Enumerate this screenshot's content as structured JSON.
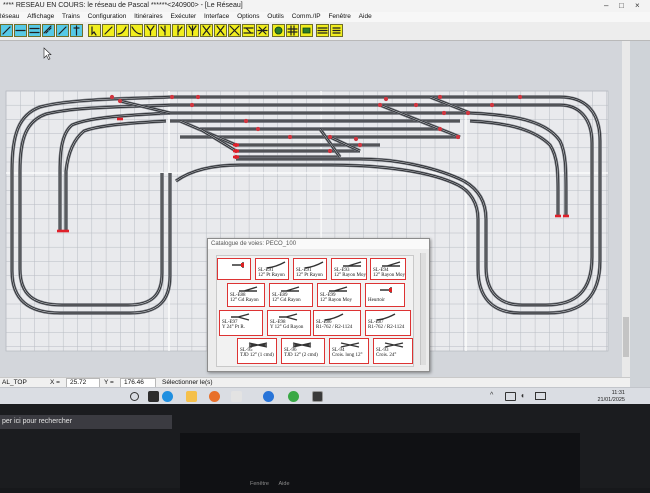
{
  "titlebar": {
    "text": "**** RESEAU EN COURS: le réseau de Pascal ******<240900> - [Le Réseau]"
  },
  "menubar": {
    "items": [
      "Réseau",
      "Affichage",
      "Trains",
      "Configuration",
      "Itinéraires",
      "Exécuter",
      "Interface",
      "Options",
      "Outils",
      "Comm./IP",
      "Fenêtre",
      "Aide"
    ]
  },
  "toolbar": {
    "buttons": [
      {
        "icon": "track-tool-icon",
        "active": true
      },
      {
        "icon": "straight-track-icon",
        "active": true
      },
      {
        "icon": "double-track-icon",
        "active": true
      },
      {
        "icon": "ruler-icon",
        "active": true
      },
      {
        "icon": "brush-icon",
        "active": true
      },
      {
        "icon": "signal-icon",
        "active": true
      },
      {
        "icon": "pointer-icon"
      },
      {
        "icon": "diagonal-track-icon"
      },
      {
        "icon": "curve-track-icon"
      },
      {
        "icon": "curve-track-2-icon"
      },
      {
        "icon": "turnout-y-icon"
      },
      {
        "icon": "turnout-left-icon"
      },
      {
        "icon": "turnout-right-icon"
      },
      {
        "icon": "three-way-turnout-icon"
      },
      {
        "icon": "double-slip-icon"
      },
      {
        "icon": "crossing-icon"
      },
      {
        "icon": "crossing-x-icon"
      },
      {
        "icon": "crossover-icon"
      },
      {
        "icon": "diamond-crossing-icon"
      },
      {
        "icon": "gear-icon"
      },
      {
        "icon": "grid-toggle-icon"
      },
      {
        "icon": "group-icon"
      },
      {
        "icon": "layers-icon"
      },
      {
        "icon": "list-icon"
      }
    ]
  },
  "catalogue": {
    "title": "Catalogue de voies: PECO_100",
    "tiles": [
      {
        "ref": "",
        "label": "",
        "shape": "buffer"
      },
      {
        "ref": "SL-E91",
        "label": "12° Pt Rayon",
        "shape": "curve"
      },
      {
        "ref": "SL-E91",
        "label": "12° Pt Rayon",
        "shape": "curve"
      },
      {
        "ref": "SL-E93",
        "label": "12° Rayon Moy",
        "shape": "turnout"
      },
      {
        "ref": "SL-E94",
        "label": "12° Rayon Moy",
        "shape": "turnout"
      },
      {
        "ref": "SL-E88",
        "label": "12° Gd Rayon",
        "shape": "turnout"
      },
      {
        "ref": "SL-E89",
        "label": "12° Gd Rayon",
        "shape": "turnout"
      },
      {
        "ref": "SL-E99",
        "label": "12° Rayon Moy",
        "shape": "turnout"
      },
      {
        "ref": "",
        "label": "Heurtoir",
        "shape": "buffer"
      },
      {
        "ref": "SL-E97",
        "label": "Y 24° Pt R.",
        "shape": "wye"
      },
      {
        "ref": "SL-E98",
        "label": "Y 12° Gd Rayon",
        "shape": "wye"
      },
      {
        "ref": "SL-E86",
        "label": "R1-762 / R2-1124",
        "shape": "curve"
      },
      {
        "ref": "SL-E87",
        "label": "R1-762 / R2-1124",
        "shape": "curve"
      },
      {
        "ref": "SL-95",
        "label": "TJD 12° (1 cmd)",
        "shape": "slip"
      },
      {
        "ref": "SL-96",
        "label": "TJD 12° (2 cmd)",
        "shape": "slip"
      },
      {
        "ref": "SL-94",
        "label": "Crois. long 12°",
        "shape": "cross"
      },
      {
        "ref": "SL-93",
        "label": "Crois. 24°",
        "shape": "cross"
      }
    ]
  },
  "statusbar": {
    "layer": "AL_TOP",
    "x_label": "X =",
    "x_value": "25.72",
    "y_label": "Y =",
    "y_value": "176.46",
    "hint": "Sélectionner le(s)"
  },
  "taskbar": {
    "time": "11:31",
    "date": "21/01/2025",
    "apps": [
      "search-icon",
      "taskview-icon",
      "edge-icon",
      "files-icon",
      "firefox-icon",
      "app-icon",
      "c-app-icon",
      "chrome-icon",
      "railway-app-icon"
    ]
  },
  "laptop": {
    "search_placeholder": "per ici pour rechercher",
    "menu_items": [
      "Fenêtre",
      "Aide"
    ]
  }
}
